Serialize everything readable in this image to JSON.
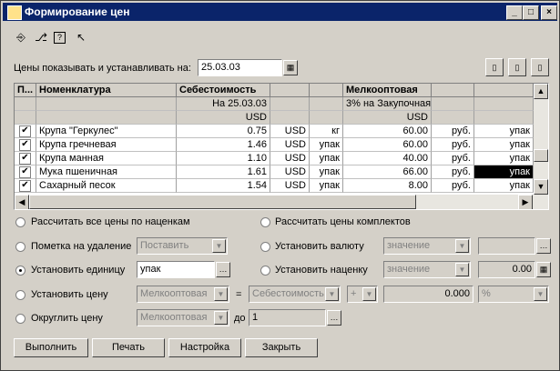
{
  "window": {
    "title": "Формирование цен",
    "min": "_",
    "max": "□",
    "close": "×"
  },
  "toolbar": {
    "icons": [
      "lock-icon",
      "unlock-icon",
      "help-icon",
      "pointer-help-icon"
    ]
  },
  "prices_label": "Цены показывать и устанавливать на:",
  "prices_date": "25.03.03",
  "table": {
    "headers": [
      "П...",
      "Номенклатура",
      "Себестоимость",
      "",
      "",
      "Мелкооптовая",
      "",
      ""
    ],
    "sub1": [
      "",
      "",
      "На 25.03.03",
      "",
      "",
      "3% на Закупочная",
      "",
      ""
    ],
    "sub2": [
      "",
      "",
      "USD",
      "",
      "",
      "USD",
      "",
      ""
    ],
    "rows": [
      {
        "check": "✔",
        "name": "Крупа \"Геркулес\"",
        "cost": "0.75",
        "cur": "USD",
        "unit": "кг",
        "price": "60.00",
        "pcur": "руб.",
        "punit": "упак"
      },
      {
        "check": "✔",
        "name": "Крупа гречневая",
        "cost": "1.46",
        "cur": "USD",
        "unit": "упак",
        "price": "60.00",
        "pcur": "руб.",
        "punit": "упак"
      },
      {
        "check": "✔",
        "name": "Крупа манная",
        "cost": "1.10",
        "cur": "USD",
        "unit": "упак",
        "price": "40.00",
        "pcur": "руб.",
        "punit": "упак"
      },
      {
        "check": "✔",
        "name": "Мука пшеничная",
        "cost": "1.61",
        "cur": "USD",
        "unit": "упак",
        "price": "66.00",
        "pcur": "руб.",
        "punit": "упак"
      },
      {
        "check": "✔",
        "name": "Сахарный песок",
        "cost": "1.54",
        "cur": "USD",
        "unit": "упак",
        "price": "8.00",
        "pcur": "руб.",
        "punit": "упак"
      }
    ]
  },
  "options": {
    "calc_all": "Рассчитать все цены по наценкам",
    "calc_sets": "Рассчитать цены комплектов",
    "mark_delete": "Пометка на удаление",
    "mark_delete_value": "Поставить",
    "set_currency": "Установить валюту",
    "set_currency_value": "значение",
    "set_unit": "Установить единицу",
    "set_unit_value": "упак",
    "set_markup": "Установить наценку",
    "set_markup_value": "значение",
    "set_markup_number": "0.00",
    "set_price": "Установить цену",
    "set_price_type": "Мелкооптовая",
    "equals": "=",
    "set_price_base": "Себестоимость",
    "set_price_op": "+",
    "set_price_number": "0.000",
    "set_price_unit": "%",
    "round_price": "Округлить цену",
    "round_price_type": "Мелкооптовая",
    "round_to_label": "до",
    "round_to_value": "1"
  },
  "buttons": {
    "execute": "Выполнить",
    "print": "Печать",
    "settings": "Настройка",
    "close": "Закрыть"
  }
}
